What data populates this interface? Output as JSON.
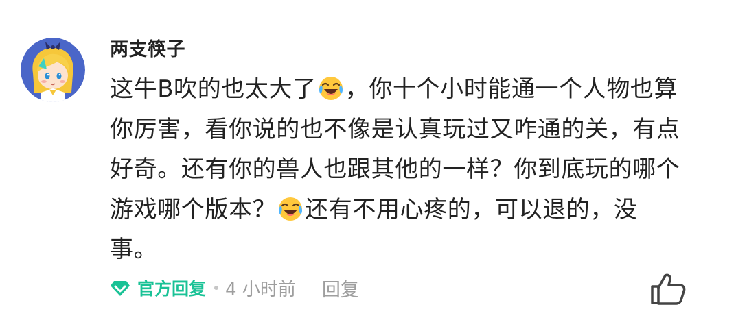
{
  "comment": {
    "username": "两支筷子",
    "lines": [
      {
        "a": "这牛B吹的也太大了",
        "emoji": "laughing-tears-emoji",
        "b": "，你十个小时能通一个人物也算"
      },
      {
        "a": "你厉害，看你说的也不像是认真玩过又咋通的关，有点"
      },
      {
        "a": "好奇。还有你的兽人也跟其他的一样？你到底玩的哪个"
      },
      {
        "a": "游戏哪个版本？",
        "emoji": "laughing-tears-emoji",
        "b": "还有不用心疼的，可以退的，没"
      },
      {
        "a": "事。"
      }
    ],
    "meta": {
      "official_label": "官方回复",
      "time": "4 小时前",
      "reply_label": "回复"
    },
    "colors": {
      "accent": "#19c296",
      "text": "#222222",
      "muted": "#9e9e9e"
    },
    "icons": {
      "official": "diamond-check-icon",
      "like": "thumbs-up-icon"
    }
  }
}
